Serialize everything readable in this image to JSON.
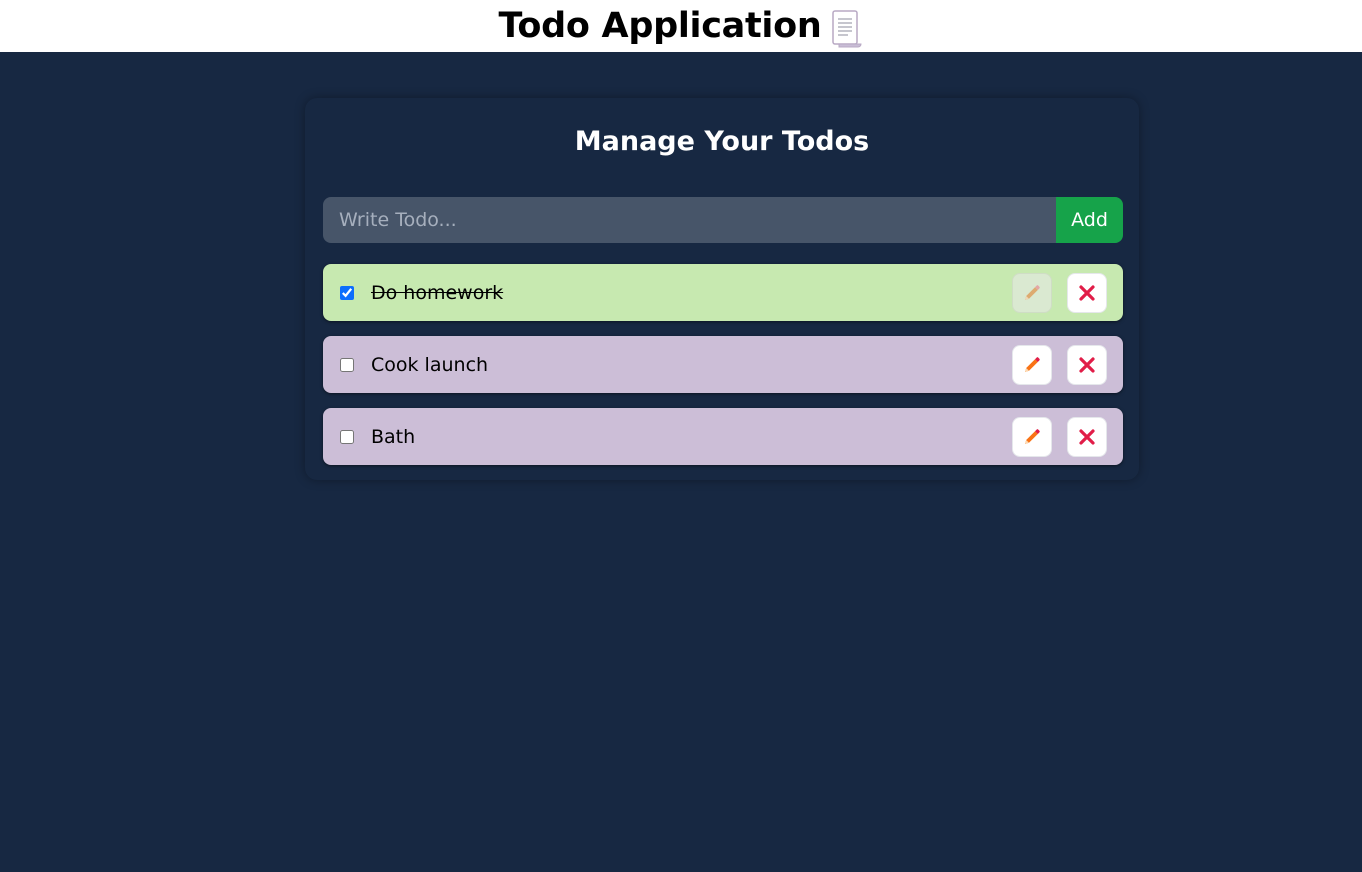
{
  "header": {
    "title": "Todo Application",
    "icon": "scroll-icon"
  },
  "main": {
    "title": "Manage Your Todos",
    "input": {
      "placeholder": "Write Todo...",
      "value": ""
    },
    "add_label": "Add"
  },
  "todos": [
    {
      "text": "Do homework",
      "completed": true,
      "edit_icon": "pencil-icon",
      "delete_icon": "close-icon"
    },
    {
      "text": "Cook launch",
      "completed": false,
      "edit_icon": "pencil-icon",
      "delete_icon": "close-icon"
    },
    {
      "text": "Bath",
      "completed": false,
      "edit_icon": "pencil-icon",
      "delete_icon": "close-icon"
    }
  ],
  "colors": {
    "background": "#172842",
    "completed_item": "#c7e9b0",
    "open_item": "#ccbed7",
    "add_button": "#16a34a",
    "input_bg": "#475569",
    "delete_icon": "#e11d48",
    "edit_icon": "#f97316"
  }
}
